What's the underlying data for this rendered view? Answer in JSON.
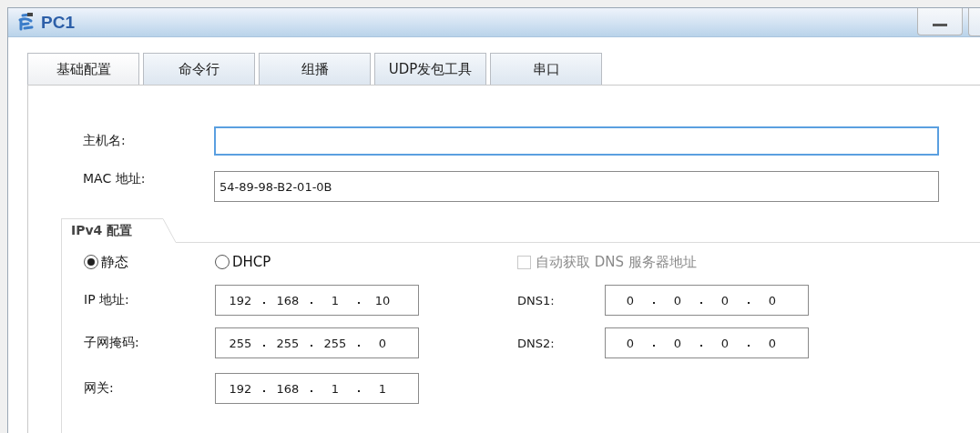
{
  "window": {
    "title": "PC1"
  },
  "tabs": [
    {
      "label": "基础配置",
      "selected": true
    },
    {
      "label": "命令行",
      "selected": false
    },
    {
      "label": "组播",
      "selected": false
    },
    {
      "label": "UDP发包工具",
      "selected": false
    },
    {
      "label": "串口",
      "selected": false
    }
  ],
  "hostname": {
    "label": "主机名:",
    "focused": true
  },
  "mac": {
    "label": "MAC 地址:",
    "value": "54-89-98-B2-01-0B",
    "focused": false
  },
  "ipv4": {
    "title": "IPv4 配置",
    "modes": [
      {
        "label": "静态",
        "selected": true
      },
      {
        "label": "DHCP",
        "selected": false
      }
    ],
    "auto_dns": {
      "label": "自动获取 DNS 服务器地址",
      "checked": false,
      "disabled": true
    },
    "address_fields": [
      {
        "label": "IP 地址:",
        "octets": [
          "192",
          "168",
          "1",
          "10"
        ]
      },
      {
        "label": "子网掩码:",
        "octets": [
          "255",
          "255",
          "255",
          "0"
        ]
      },
      {
        "label": "网关:",
        "octets": [
          "192",
          "168",
          "1",
          "1"
        ]
      }
    ],
    "dns_fields": [
      {
        "label": "DNS1:",
        "octets": [
          "0",
          "0",
          "0",
          "0"
        ]
      },
      {
        "label": "DNS2:",
        "octets": [
          "0",
          "0",
          "0",
          "0"
        ]
      }
    ]
  }
}
